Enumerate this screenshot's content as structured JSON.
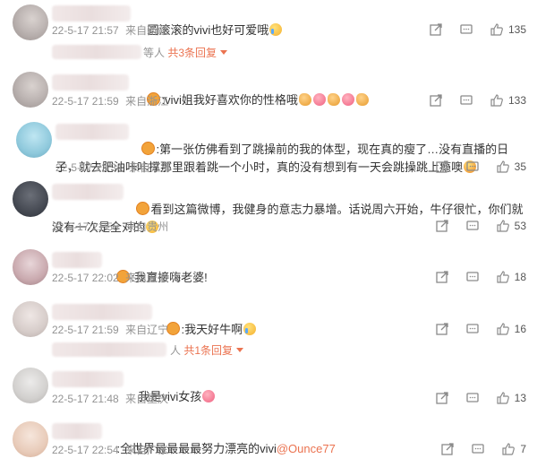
{
  "comments": [
    {
      "text": "圆滚滚的vivi也好可爱哦",
      "emoji": "crying-face",
      "time": "22-5-17 21:57",
      "location": "来自新疆",
      "likes": "135",
      "replies": {
        "prefix": "等人",
        "label": "共3条回复"
      }
    },
    {
      "text": ":vivi姐我好喜欢你的性格哦",
      "emoji": "heart-cheer",
      "time": "22-5-17 21:59",
      "location": "来自浙江",
      "likes": "133"
    },
    {
      "text": ":第一张仿佛看到了跳操前的我的体型，现在真的瘦了…没有直播的日子，就去肥油咔咔撑那里跟着跳一个小时，真的没有想到有一天会跳操跳上瘾噢",
      "emoji": "grinning-face",
      "time": "22-5-17 22:34",
      "location": "来自江苏",
      "likes": "35"
    },
    {
      "text": "看到这篇微博，我健身的意志力暴增。话说周六开始，牛仔很忙，你们就没有一次是全对的",
      "emoji": "smile-face",
      "time": "22-5-17 21:56",
      "location": "来自贵州",
      "likes": "53"
    },
    {
      "text": ":我直接嗨老婆!",
      "time": "22-5-17 22:02",
      "location": "来自安徽",
      "likes": "18"
    },
    {
      "text": ":我天好牛啊",
      "emoji": "crying-face",
      "time": "22-5-17 21:59",
      "location": "来自辽宁",
      "likes": "16",
      "replies": {
        "prefix": "人",
        "label": "共1条回复"
      }
    },
    {
      "text": "我是vivi女孩",
      "emoji": "love-face",
      "time": "22-5-17 21:48",
      "location": "来自重庆",
      "likes": "13"
    },
    {
      "text": ":全世界最最最最努力漂亮的vivi",
      "mention": "@Ounce77",
      "time": "22-5-17 22:54",
      "location": "来自广东",
      "likes": "7"
    }
  ]
}
